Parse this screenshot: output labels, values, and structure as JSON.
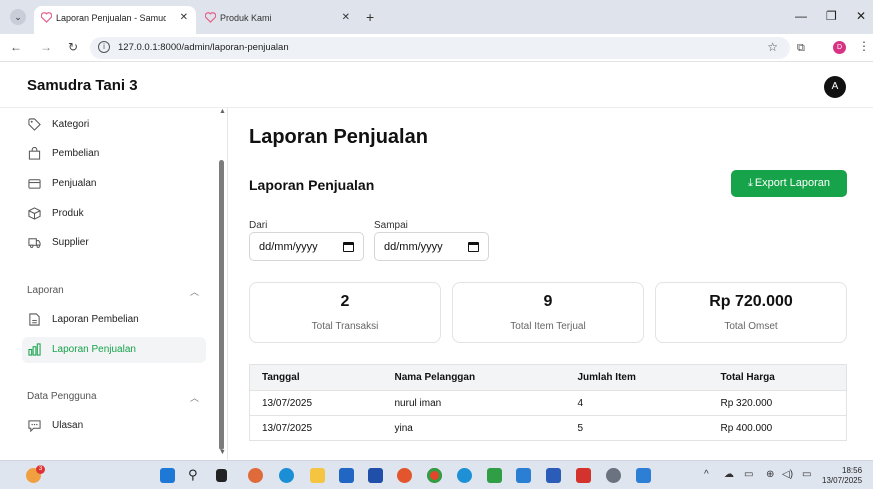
{
  "browser": {
    "tabs": [
      {
        "title": "Laporan Penjualan - Samudra T",
        "active": true,
        "close": "✕"
      },
      {
        "title": "Produk Kami",
        "active": false,
        "close": "✕"
      }
    ],
    "new_tab": "+",
    "window_controls": {
      "minimize": "—",
      "restore": "❐",
      "close": "✕"
    },
    "url": "127.0.0.1:8000/admin/laporan-penjualan",
    "profile_initial": "D"
  },
  "app": {
    "brand": "Samudra Tani 3",
    "avatar_initial": "A",
    "accent_color": "#16a34a"
  },
  "sidebar": {
    "items": [
      {
        "label": "Kategori",
        "icon": "tag-icon"
      },
      {
        "label": "Pembelian",
        "icon": "shopping-bag-icon"
      },
      {
        "label": "Penjualan",
        "icon": "card-icon"
      },
      {
        "label": "Produk",
        "icon": "box-icon"
      },
      {
        "label": "Supplier",
        "icon": "truck-icon"
      }
    ],
    "group_laporan": "Laporan",
    "laporan_items": [
      {
        "label": "Laporan Pembelian",
        "icon": "document-icon",
        "active": false
      },
      {
        "label": "Laporan Penjualan",
        "icon": "bar-chart-icon",
        "active": true
      }
    ],
    "group_data": "Data Pengguna",
    "data_items": [
      {
        "label": "Ulasan",
        "icon": "chat-icon"
      }
    ]
  },
  "main": {
    "page_title": "Laporan Penjualan",
    "section_title": "Laporan Penjualan",
    "export_label": "Export Laporan",
    "filter": {
      "from_label": "Dari",
      "from_value": "dd/mm/yyyy",
      "to_label": "Sampai",
      "to_value": "dd/mm/yyyy"
    },
    "stats": [
      {
        "value": "2",
        "caption": "Total Transaksi"
      },
      {
        "value": "9",
        "caption": "Total Item Terjual"
      },
      {
        "value": "Rp 720.000",
        "caption": "Total Omset"
      }
    ],
    "table": {
      "headers": [
        "Tanggal",
        "Nama Pelanggan",
        "Jumlah Item",
        "Total Harga"
      ],
      "rows": [
        [
          "13/07/2025",
          "nurul iman",
          "4",
          "Rp 320.000"
        ],
        [
          "13/07/2025",
          "yina",
          "5",
          "Rp 400.000"
        ]
      ]
    }
  },
  "taskbar": {
    "time": "18:56",
    "date": "13/07/2025",
    "notification_count": "3"
  }
}
